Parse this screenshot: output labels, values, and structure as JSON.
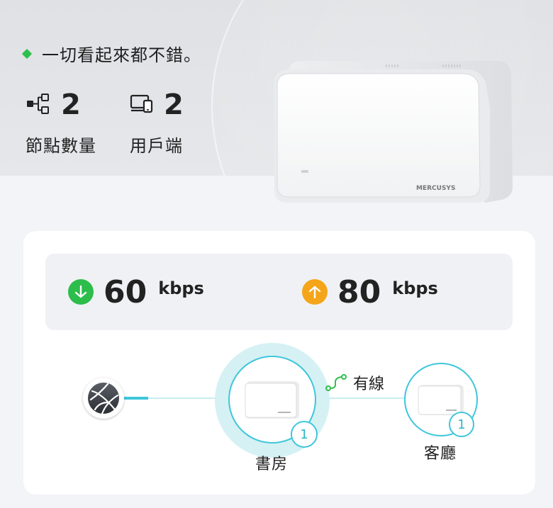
{
  "status": {
    "text": "一切看起來都不錯。",
    "color": "#2fbf4d"
  },
  "stats": {
    "nodes": {
      "icon": "network-nodes-icon",
      "value": "2",
      "label": "節點數量"
    },
    "clients": {
      "icon": "devices-icon",
      "value": "2",
      "label": "用戶端"
    }
  },
  "device": {
    "brand": "MERCUSYS"
  },
  "speed": {
    "download": {
      "icon": "arrow-down-icon",
      "value": "60",
      "unit": "kbps",
      "color": "#2cbd4b"
    },
    "upload": {
      "icon": "arrow-up-icon",
      "value": "80",
      "unit": "kbps",
      "color": "#f5a519"
    }
  },
  "topology": {
    "internet_icon": "globe-icon",
    "link_type": "有線",
    "main_node": {
      "label": "書房",
      "clients": "1"
    },
    "satellite_node": {
      "label": "客廳",
      "clients": "1"
    },
    "accent": "#3fc6dc"
  }
}
